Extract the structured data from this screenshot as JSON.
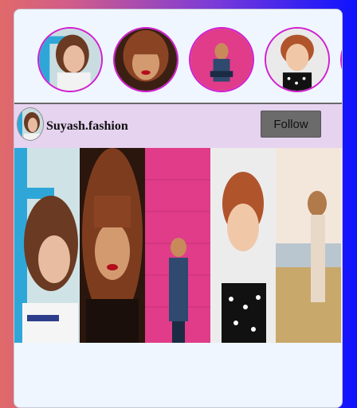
{
  "stories": [
    {
      "name": "story-1",
      "icon": "portrait-woman-blue-frame"
    },
    {
      "name": "story-2",
      "icon": "portrait-woman-bangs-red-lips"
    },
    {
      "name": "story-3",
      "icon": "portrait-woman-pink-wall"
    },
    {
      "name": "story-4",
      "icon": "portrait-woman-smiling-polka-dot"
    },
    {
      "name": "story-5",
      "icon": "portrait-partial"
    }
  ],
  "post": {
    "username": "Suyash.fashion",
    "follow_label": "Follow",
    "avatar_icon": "portrait-woman-avatar"
  },
  "gallery": [
    {
      "icon": "photo-woman-blue-frame"
    },
    {
      "icon": "photo-woman-bangs"
    },
    {
      "icon": "photo-woman-pink-wall"
    },
    {
      "icon": "photo-woman-smiling"
    },
    {
      "icon": "photo-woman-field"
    }
  ],
  "colors": {
    "story_ring": "#d11fd1",
    "card_bg": "#f0f6ff",
    "header_bg": "#e6d3f0",
    "follow_bg": "#6b6b6b"
  }
}
